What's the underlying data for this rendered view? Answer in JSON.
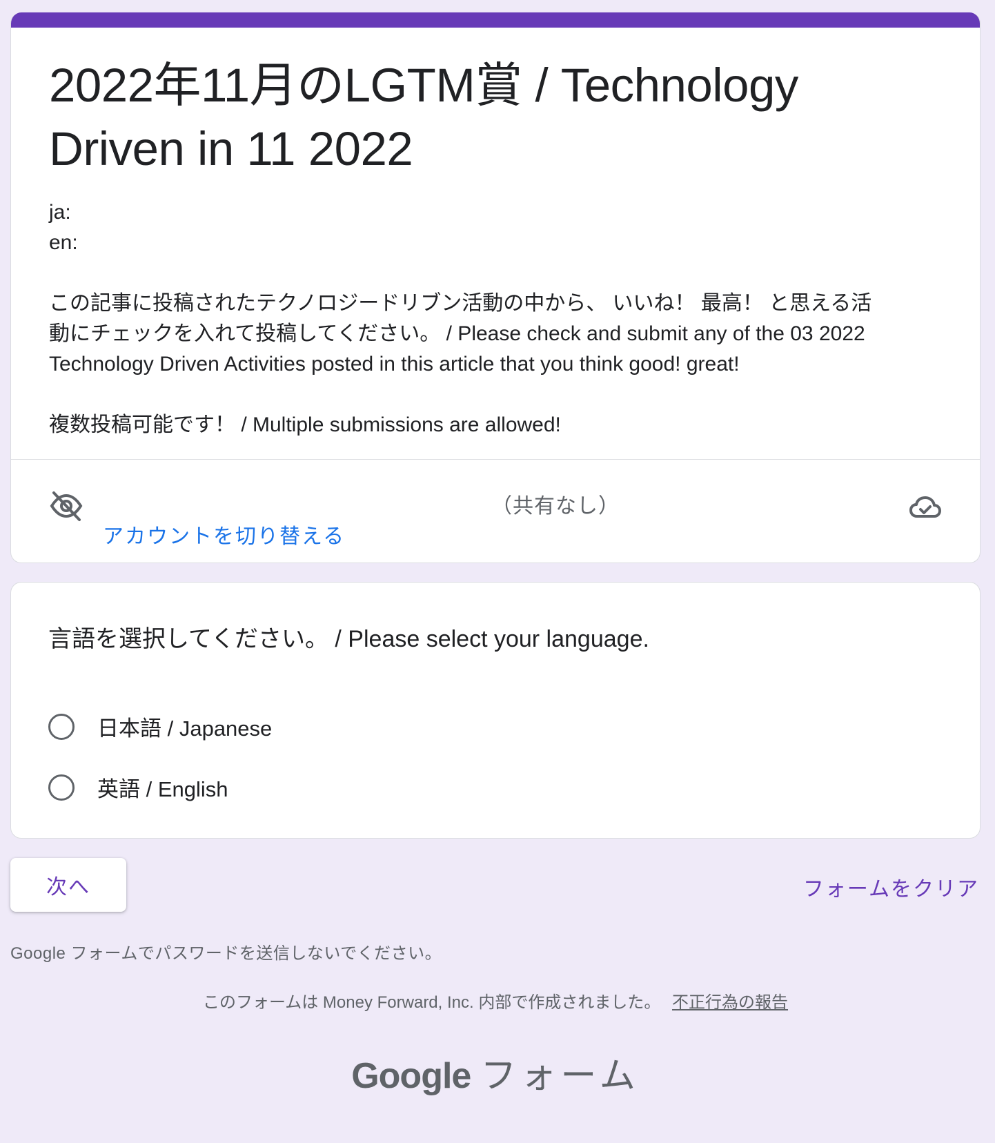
{
  "form": {
    "title_line1": "2022年11月のLGTM賞 / Technology",
    "title_line2": "Driven in 11 2022",
    "desc_ja": "ja:",
    "desc_en": "en:",
    "desc_main_1": "この記事に投稿されたテクノロジードリブン活動の中から、 いいね！ 最高！ と思える活",
    "desc_main_2": "動にチェックを入れて投稿してください。 / Please check and submit any of the 03 2022",
    "desc_main_3": "Technology Driven Activities posted in this article that you think good! great!",
    "desc_multi": "複数投稿可能です！ / Multiple submissions are allowed!",
    "shared_status": "（共有なし）",
    "switch_account": "アカウントを切り替える",
    "accent_color": "#673ab7"
  },
  "question": {
    "title": "言語を選択してください。 / Please select your language.",
    "options": [
      {
        "label": "日本語 / Japanese",
        "selected": false
      },
      {
        "label": "英語 / English",
        "selected": false
      }
    ]
  },
  "actions": {
    "next_label": "次へ",
    "clear_label": "フォームをクリア"
  },
  "footer": {
    "password_note": "Google フォームでパスワードを送信しないでください。",
    "created_by": "このフォームは Money Forward, Inc. 内部で作成されました。",
    "report_link": "不正行為の報告",
    "brand_google": "Google",
    "brand_forms": "フォーム"
  },
  "icons": {
    "visibility_off": "eye-off-icon",
    "cloud_done": "cloud-check-icon"
  }
}
